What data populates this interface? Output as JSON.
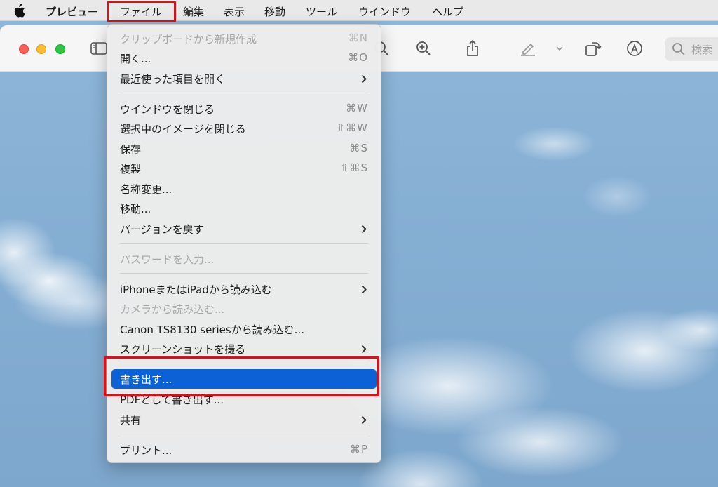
{
  "menubar": {
    "app_name": "プレビュー",
    "items": [
      "ファイル",
      "編集",
      "表示",
      "移動",
      "ツール",
      "ウインドウ",
      "ヘルプ"
    ]
  },
  "toolbar": {
    "icons": [
      "sidebar-icon",
      "zoom-out-icon",
      "zoom-in-icon",
      "share-icon",
      "highlight-pen-icon",
      "chevron-down-icon",
      "rotate-icon",
      "markup-icon",
      "search-icon"
    ],
    "search_placeholder": "検索"
  },
  "file_menu": {
    "items": [
      {
        "label": "クリップボードから新規作成",
        "shortcut": "⌘N",
        "disabled": true
      },
      {
        "label": "開く...",
        "shortcut": "⌘O"
      },
      {
        "label": "最近使った項目を開く",
        "submenu": true
      },
      {
        "label": "ウインドウを閉じる",
        "shortcut": "⌘W"
      },
      {
        "label": "選択中のイメージを閉じる",
        "shortcut": "⇧⌘W"
      },
      {
        "label": "保存",
        "shortcut": "⌘S"
      },
      {
        "label": "複製",
        "shortcut": "⇧⌘S"
      },
      {
        "label": "名称変更..."
      },
      {
        "label": "移動..."
      },
      {
        "label": "バージョンを戻す",
        "submenu": true
      },
      {
        "label": "パスワードを入力...",
        "disabled": true
      },
      {
        "label": "iPhoneまたはiPadから読み込む",
        "submenu": true
      },
      {
        "label": "カメラから読み込む...",
        "disabled": true
      },
      {
        "label": "Canon TS8130 seriesから読み込む..."
      },
      {
        "label": "スクリーンショットを撮る",
        "submenu": true
      },
      {
        "label": "書き出す...",
        "selected": true
      },
      {
        "label": "PDFとして書き出す..."
      },
      {
        "label": "共有",
        "submenu": true
      },
      {
        "label": "プリント...",
        "shortcut": "⌘P"
      }
    ]
  },
  "colors": {
    "highlight_box": "#d6131b",
    "selection": "#0a62d6",
    "close": "#fe5f57",
    "minimize": "#febc2e",
    "zoom": "#28c840"
  }
}
